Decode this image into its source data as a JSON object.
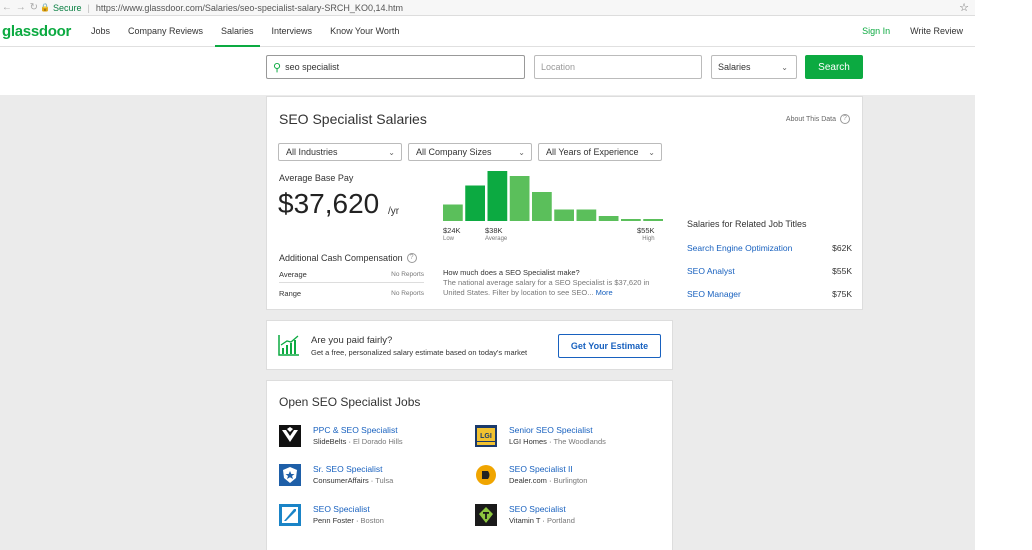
{
  "browser": {
    "secure_label": "Secure",
    "url": "https://www.glassdoor.com/Salaries/seo-specialist-salary-SRCH_KO0,14.htm",
    "back_icon": "back-arrow-icon",
    "forward_icon": "forward-arrow-icon",
    "refresh_icon": "refresh-icon"
  },
  "header": {
    "logo": "glassdoor",
    "nav": [
      "Jobs",
      "Company Reviews",
      "Salaries",
      "Interviews",
      "Know Your Worth"
    ],
    "active_nav": "Salaries",
    "sign_in": "Sign In",
    "write_review": "Write Review"
  },
  "search": {
    "keyword_value": "seo specialist",
    "location_placeholder": "Location",
    "type_selected": "Salaries",
    "search_button": "Search"
  },
  "salary": {
    "title": "SEO Specialist Salaries",
    "about": "About This Data",
    "filters": [
      "All Industries",
      "All Company Sizes",
      "All Years of Experience"
    ],
    "avg_label": "Average Base Pay",
    "avg_value": "$37,620",
    "avg_unit": "/yr",
    "additional_cash": "Additional Cash Compensation",
    "cash_rows": [
      {
        "label": "Average",
        "value": "No Reports"
      },
      {
        "label": "Range",
        "value": "No Reports"
      }
    ],
    "histogram": {
      "values": [
        0.33,
        0.71,
        1.0,
        0.9,
        0.58,
        0.23,
        0.23,
        0.1,
        0.04,
        0.04
      ],
      "highlight": [
        1,
        2
      ],
      "color_light": "#5bbf5b",
      "color_dark": "#0caa41"
    },
    "hist_labels": {
      "low": "$24K",
      "low_sub": "Low",
      "mid": "$38K",
      "mid_sub": "Average",
      "high": "$55K",
      "high_sub": "High"
    },
    "how_title": "How much does a SEO Specialist make?",
    "how_text": "The national average salary for a SEO Specialist is $37,620 in United States. Filter by location to see SEO...",
    "more": "More",
    "related_title": "Salaries for Related Job Titles",
    "related": [
      {
        "name": "Search Engine Optimization",
        "pay": "$62K"
      },
      {
        "name": "SEO Analyst",
        "pay": "$55K"
      },
      {
        "name": "SEO Manager",
        "pay": "$75K"
      }
    ]
  },
  "estimate": {
    "title": "Are you paid fairly?",
    "subtitle": "Get a free, personalized salary estimate based on today's market",
    "button": "Get Your Estimate"
  },
  "jobs": {
    "title": "Open SEO Specialist Jobs",
    "items": [
      {
        "title": "PPC & SEO Specialist",
        "company": "SlideBelts",
        "location": "El Dorado Hills"
      },
      {
        "title": "Senior SEO Specialist",
        "company": "LGI Homes",
        "location": "The Woodlands"
      },
      {
        "title": "Sr. SEO Specialist",
        "company": "ConsumerAffairs",
        "location": "Tulsa"
      },
      {
        "title": "SEO Specialist II",
        "company": "Dealer.com",
        "location": "Burlington"
      },
      {
        "title": "SEO Specialist",
        "company": "Penn Foster",
        "location": "Boston"
      },
      {
        "title": "SEO Specialist",
        "company": "Vitamin T",
        "location": "Portland"
      }
    ]
  }
}
